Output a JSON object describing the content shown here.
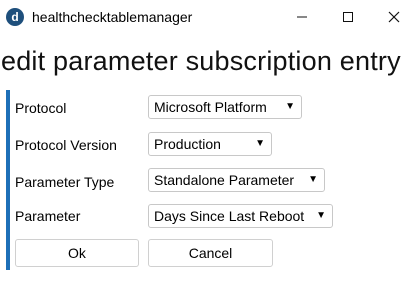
{
  "window": {
    "title": "healthchecktablemanager",
    "icon_glyph": "d",
    "icon_color": "#1e4f7c"
  },
  "page": {
    "title": "edit parameter subscription entry",
    "accent_color": "#1d6fb8"
  },
  "form": {
    "protocol": {
      "label": "Protocol",
      "value": "Microsoft Platform"
    },
    "protocol_version": {
      "label": "Protocol Version",
      "value": "Production"
    },
    "parameter_type": {
      "label": "Parameter Type",
      "value": "Standalone Parameter"
    },
    "parameter": {
      "label": "Parameter",
      "value": "Days Since Last Reboot"
    }
  },
  "buttons": {
    "ok": "Ok",
    "cancel": "Cancel"
  }
}
